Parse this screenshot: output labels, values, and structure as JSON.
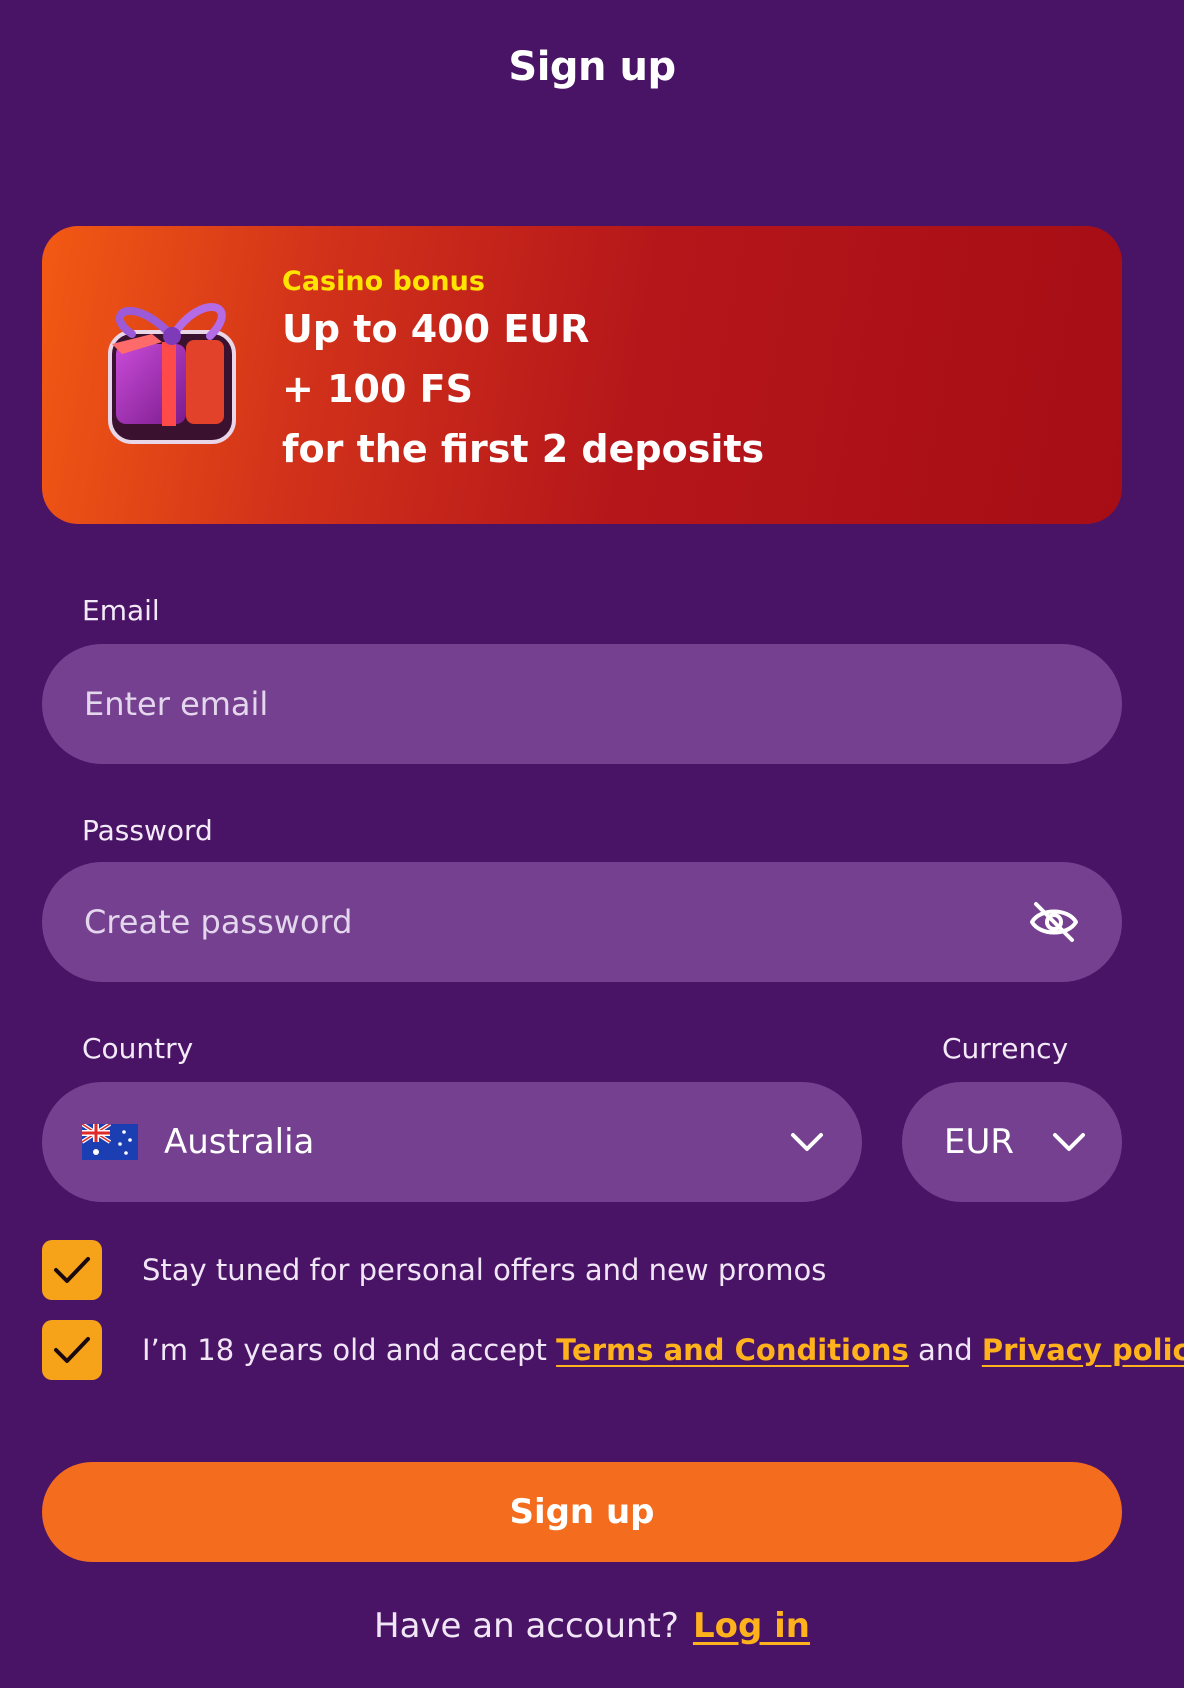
{
  "page": {
    "title": "Sign up"
  },
  "banner": {
    "kicker": "Casino bonus",
    "line1": "Up to 400 EUR",
    "line2": "+ 100 FS",
    "line3": "for the first 2 deposits",
    "icon": "gift-icon"
  },
  "email": {
    "label": "Email",
    "placeholder": "Enter email",
    "value": ""
  },
  "password": {
    "label": "Password",
    "placeholder": "Create password",
    "value": "",
    "icon": "eye-slash-icon"
  },
  "country": {
    "label": "Country",
    "value": "Australia",
    "flag": "australia-flag-icon"
  },
  "currency": {
    "label": "Currency",
    "value": "EUR"
  },
  "consents": {
    "promos": {
      "text": "Stay tuned for personal offers and new promos",
      "checked": true
    },
    "age": {
      "prefix": "I’m 18 years old and accept ",
      "terms_link": "Terms and Conditions",
      "middle": " and ",
      "privacy_link": "Privacy policy",
      "checked": true
    }
  },
  "submit": {
    "label": "Sign up"
  },
  "footer": {
    "prompt": "Have an account?",
    "login_link": "Log in"
  },
  "colors": {
    "background": "#4a1466",
    "field": "#74408f",
    "accent_orange": "#f46c1d",
    "checkbox": "#f7a31a",
    "link": "#ffb21c",
    "kicker": "#ffe400"
  }
}
